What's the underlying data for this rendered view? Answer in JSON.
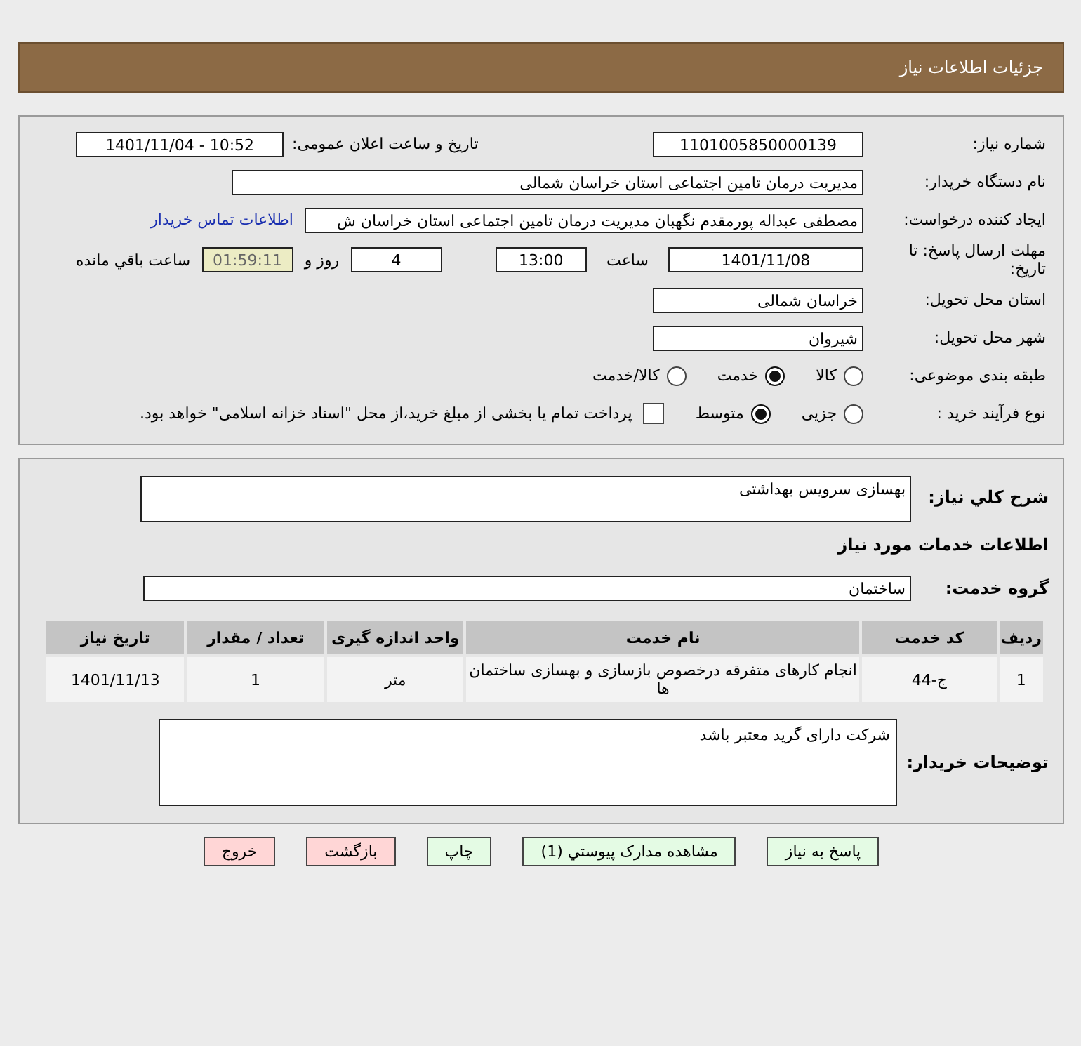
{
  "header": {
    "title": "جزئیات اطلاعات نیاز"
  },
  "details": {
    "need_number": {
      "label": "شماره نیاز:",
      "value": "1101005850000139"
    },
    "announce": {
      "label": "تاریخ و ساعت اعلان عمومی:",
      "value": "1401/11/04 - 10:52"
    },
    "buyer_org": {
      "label": "نام دستگاه خریدار:",
      "value": "مدیریت درمان تامین اجتماعی استان خراسان شمالی"
    },
    "requester": {
      "label": "ایجاد کننده درخواست:",
      "value": "مصطفی عبداله پورمقدم نگهبان مدیریت درمان تامین اجتماعی استان خراسان ش",
      "link": "اطلاعات تماس خریدار"
    },
    "deadline": {
      "label": "مهلت ارسال پاسخ: تا تاریخ:",
      "date": "1401/11/08",
      "time_label": "ساعت",
      "time": "13:00",
      "days": "4",
      "days_label": "روز و",
      "remaining": "01:59:11",
      "remaining_label": "ساعت باقي مانده"
    },
    "province": {
      "label": "استان محل تحویل:",
      "value": "خراسان شمالی"
    },
    "city": {
      "label": "شهر محل تحویل:",
      "value": "شیروان"
    },
    "category": {
      "label": "طبقه بندی موضوعی:",
      "options": [
        {
          "label": "کالا",
          "selected": false
        },
        {
          "label": "خدمت",
          "selected": true
        },
        {
          "label": "کالا/خدمت",
          "selected": false
        }
      ]
    },
    "process": {
      "label": "نوع فرآیند خرید :",
      "options": [
        {
          "label": "جزیی",
          "selected": false
        },
        {
          "label": "متوسط",
          "selected": true
        }
      ],
      "treasury": {
        "checked": false,
        "text": "پرداخت تمام یا بخشی از مبلغ خرید،از محل \"اسناد خزانه اسلامی\" خواهد بود."
      }
    }
  },
  "summary": {
    "label": "شرح کلي نیاز:",
    "value": "بهسازی سرویس بهداشتی"
  },
  "services_heading": "اطلاعات خدمات مورد نیاز",
  "service_group": {
    "label": "گروه خدمت:",
    "value": "ساختمان"
  },
  "table": {
    "columns": [
      "ردیف",
      "کد خدمت",
      "نام خدمت",
      "واحد اندازه گیری",
      "تعداد / مقدار",
      "تاریخ نیاز"
    ],
    "rows": [
      [
        "1",
        "ج-44",
        "انجام کارهای متفرقه درخصوص بازسازی و بهسازی ساختمان ها",
        "متر",
        "1",
        "1401/11/13"
      ]
    ]
  },
  "buyer_notes": {
    "label": "توضیحات خریدار:",
    "value": "شرکت دارای گرید معتبر باشد"
  },
  "buttons": [
    {
      "label": "پاسخ به نیاز",
      "kind": "action"
    },
    {
      "label": "مشاهده مدارک پیوستي (1)",
      "kind": "action"
    },
    {
      "label": "چاپ",
      "kind": "action"
    },
    {
      "label": "بازگشت",
      "kind": "exit"
    },
    {
      "label": "خروج",
      "kind": "exit"
    }
  ]
}
